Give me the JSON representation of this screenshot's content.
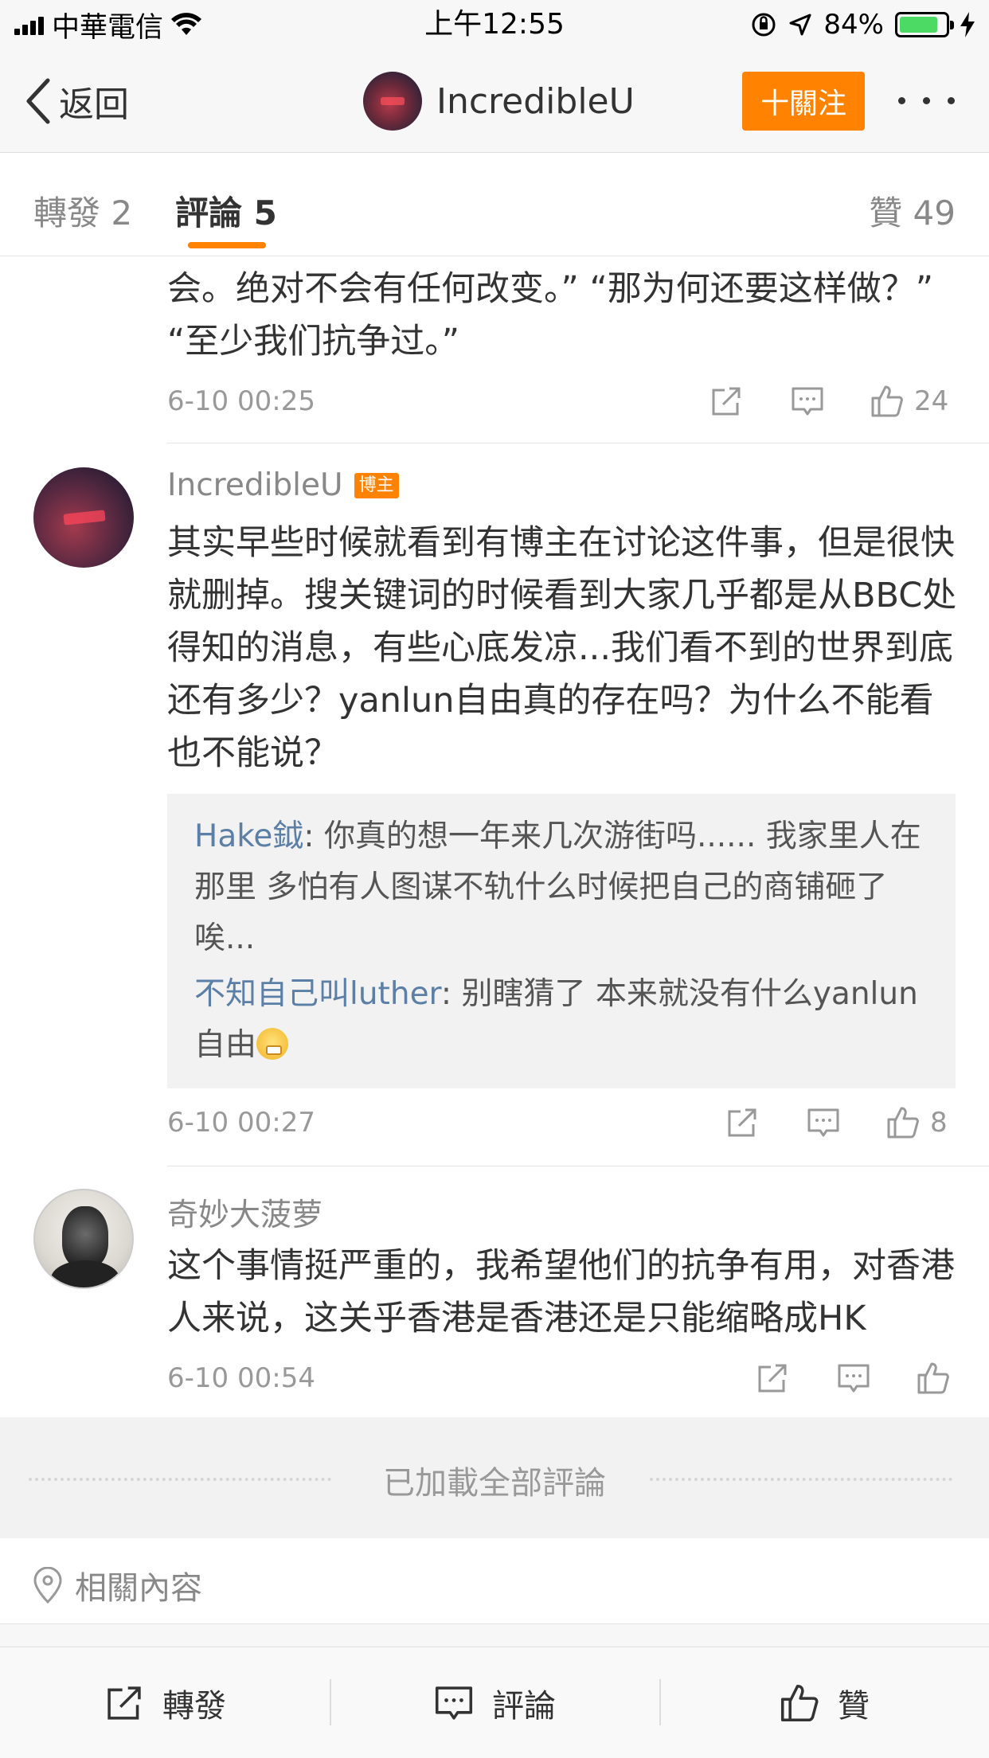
{
  "status_bar": {
    "carrier": "中華電信",
    "time": "上午12:55",
    "battery": "84%",
    "battery_level": 0.84
  },
  "nav": {
    "back_label": "返回",
    "title": "IncredibleU",
    "follow_label": "十關注"
  },
  "tabs": {
    "repost": "轉發 2",
    "comments": "評論 5",
    "likes": "贊 49"
  },
  "comments": [
    {
      "text": "会。绝对不会有任何改变。” “那为何还要这样做？” “至少我们抗争过。”",
      "time": "6-10 00:25",
      "likes": "24"
    },
    {
      "name": "IncredibleU",
      "badge": "博主",
      "text": "其实早些时候就看到有博主在讨论这件事，但是很快就删掉。搜关键词的时候看到大家几乎都是从BBC处得知的消息，有些心底发凉...我们看不到的世界到底还有多少？yanlun自由真的存在吗？为什么不能看也不能说？",
      "replies": [
        {
          "name": "Hake鉞",
          "text": ": 你真的想一年来几次游街吗...... 我家里人在那里 多怕有人图谋不轨什么时候把自己的商铺砸了 唉..."
        },
        {
          "name": "不知自己叫luther",
          "text": ": 别瞎猜了 本来就没有什么yanlun自由"
        }
      ],
      "time": "6-10 00:27",
      "likes": "8"
    },
    {
      "name": "奇妙大菠萝",
      "text": "这个事情挺严重的，我希望他们的抗争有用，对香港人来说，这关乎香港是香港还是只能缩略成HK",
      "time": "6-10 00:54",
      "likes": ""
    }
  ],
  "loaded_all": "已加載全部評論",
  "related": "相關內容",
  "bottom_bar": {
    "repost": "轉發",
    "comment": "評論",
    "like": "贊"
  },
  "colors": {
    "accent": "#ff8200",
    "reply_name": "#5b7fa6"
  }
}
